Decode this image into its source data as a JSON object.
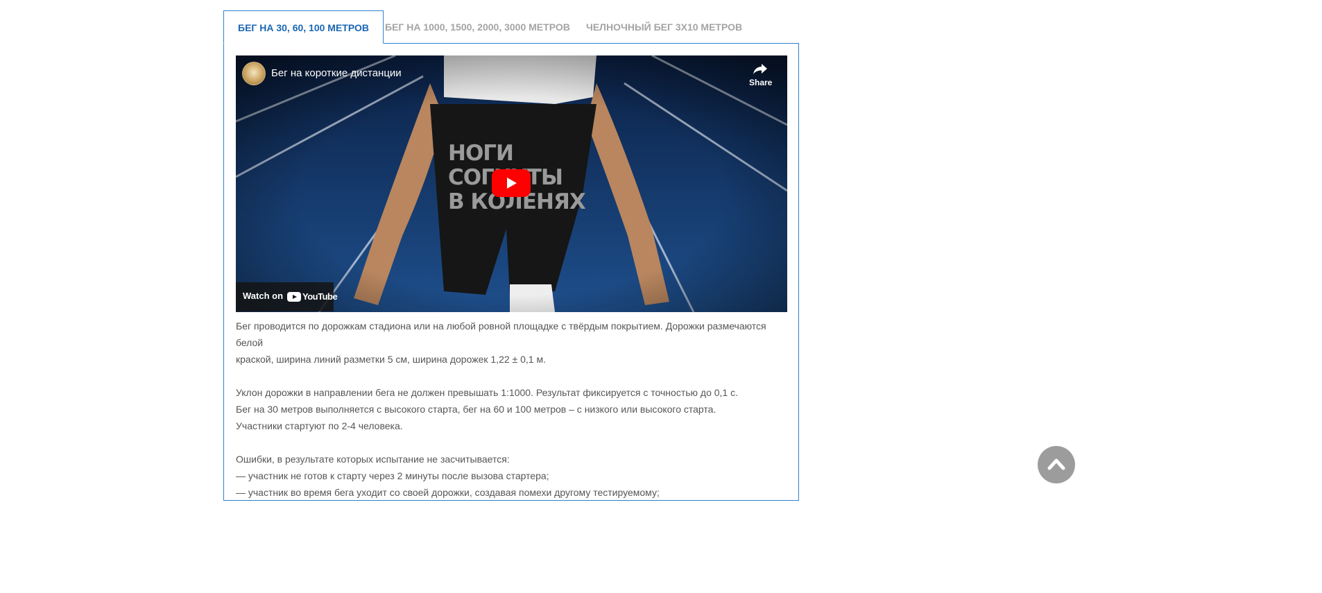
{
  "tabs": [
    {
      "label": "БЕГ НА 30, 60, 100 МЕТРОВ",
      "active": true
    },
    {
      "label": "БЕГ НА 1000, 1500, 2000, 3000 МЕТРОВ",
      "active": false
    },
    {
      "label": "ЧЕЛНОЧНЫЙ БЕГ 3Х10 МЕТРОВ",
      "active": false
    }
  ],
  "video": {
    "title": "Бег на короткие дистанции",
    "share_label": "Share",
    "overlay_text": "НОГИ\nСОГНУТЫ\nВ КОЛЕНЯХ",
    "watch_on_label": "Watch on",
    "youtube_label": "YouTube",
    "play_color": "#ff0000"
  },
  "content": {
    "paragraphs": [
      [
        "Бег проводится по дорожкам стадиона или на любой ровной площадке с твёрдым покрытием. Дорожки размечаются белой",
        "краской, ширина линий разметки 5 см, ширина дорожек 1,22 ± 0,1 м."
      ],
      [
        "Уклон дорожки в направлении бега не должен превышать 1:1000. Результат фиксируется с точностью до 0,1 с.",
        "Бег на 30 метров выполняется с высокого старта, бег на 60 и 100 метров – с низкого или высокого старта.",
        "Участники стартуют по 2-4 человека."
      ],
      [
        "Ошибки, в результате которых испытание не засчитывается:",
        "— участник не готов к старту через 2 минуты после вызова стартера;",
        "— участник во время бега уходит со своей дорожки, создавая помехи другому тестируемому;"
      ]
    ]
  },
  "colors": {
    "accent": "#1a66b3",
    "border": "#2a82d0",
    "inactive_tab": "#a4a4a4",
    "text": "#555555",
    "scroll_button": "#9c9c9c"
  },
  "icons": {
    "share": "share-icon",
    "play": "play-icon",
    "scroll_top": "chevron-up-icon",
    "youtube": "youtube-icon"
  }
}
